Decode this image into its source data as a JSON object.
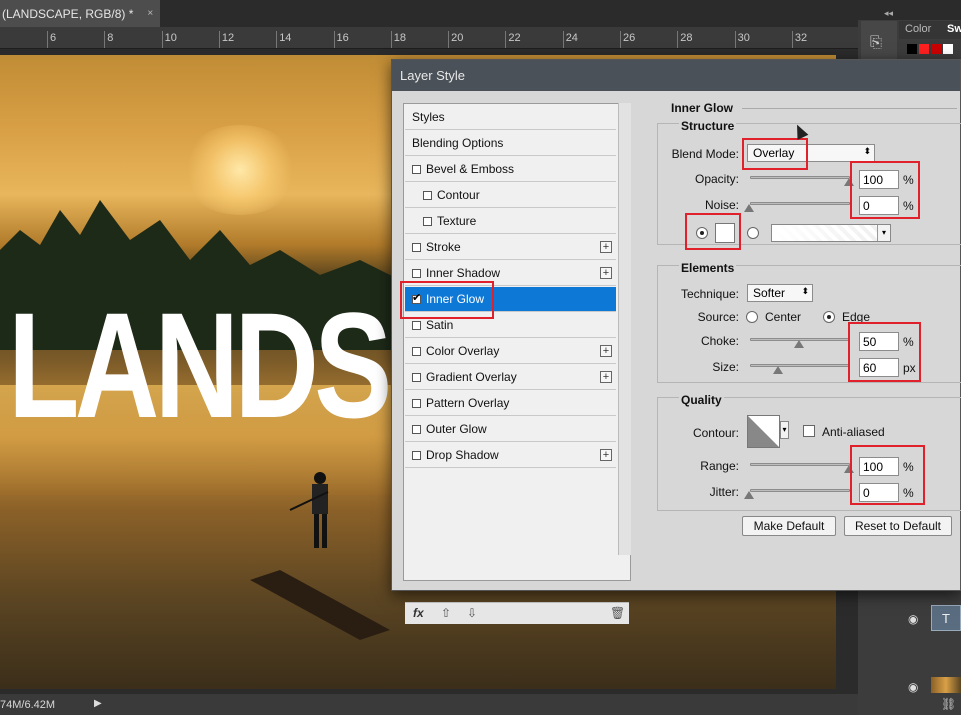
{
  "document": {
    "tab_title": "(LANDSCAPE, RGB/8) *",
    "tab_close": "×",
    "ruler_labels": [
      "6",
      "8",
      "10",
      "12",
      "14",
      "16",
      "18",
      "20",
      "22",
      "24",
      "26",
      "28",
      "30",
      "32"
    ],
    "canvas_text": "LANDS",
    "status_text": "74M/6.42M",
    "status_arrow": "▶"
  },
  "right_panel": {
    "collapse": "◂◂",
    "tab_color": "Color",
    "tab_swatches": "Sw",
    "swatch_colors": [
      "#000000",
      "#ff2020",
      "#cc0000",
      "#ffffff"
    ]
  },
  "dialog": {
    "title": "Layer Style",
    "styles": [
      {
        "label": "Styles",
        "checkbox": false,
        "checked": false,
        "plus": false,
        "indent": 0,
        "active": false
      },
      {
        "label": "Blending Options",
        "checkbox": false,
        "checked": false,
        "plus": false,
        "indent": 0,
        "active": false
      },
      {
        "label": "Bevel & Emboss",
        "checkbox": true,
        "checked": false,
        "plus": false,
        "indent": 0,
        "active": false
      },
      {
        "label": "Contour",
        "checkbox": true,
        "checked": false,
        "plus": false,
        "indent": 1,
        "active": false
      },
      {
        "label": "Texture",
        "checkbox": true,
        "checked": false,
        "plus": false,
        "indent": 1,
        "active": false
      },
      {
        "label": "Stroke",
        "checkbox": true,
        "checked": false,
        "plus": true,
        "indent": 0,
        "active": false
      },
      {
        "label": "Inner Shadow",
        "checkbox": true,
        "checked": false,
        "plus": true,
        "indent": 0,
        "active": false
      },
      {
        "label": "Inner Glow",
        "checkbox": true,
        "checked": true,
        "plus": false,
        "indent": 0,
        "active": true
      },
      {
        "label": "Satin",
        "checkbox": true,
        "checked": false,
        "plus": false,
        "indent": 0,
        "active": false
      },
      {
        "label": "Color Overlay",
        "checkbox": true,
        "checked": false,
        "plus": true,
        "indent": 0,
        "active": false
      },
      {
        "label": "Gradient Overlay",
        "checkbox": true,
        "checked": false,
        "plus": true,
        "indent": 0,
        "active": false
      },
      {
        "label": "Pattern Overlay",
        "checkbox": true,
        "checked": false,
        "plus": false,
        "indent": 0,
        "active": false
      },
      {
        "label": "Outer Glow",
        "checkbox": true,
        "checked": false,
        "plus": false,
        "indent": 0,
        "active": false
      },
      {
        "label": "Drop Shadow",
        "checkbox": true,
        "checked": false,
        "plus": true,
        "indent": 0,
        "active": false
      }
    ],
    "footer": {
      "fx": "fx",
      "up": "⇧",
      "down": "⇩",
      "trash": "🗑"
    },
    "inner_glow": {
      "heading": "Inner Glow",
      "structure": {
        "heading": "Structure",
        "blend_mode_label": "Blend Mode:",
        "blend_mode": "Overlay",
        "opacity_label": "Opacity:",
        "opacity": "100",
        "opacity_unit": "%",
        "noise_label": "Noise:",
        "noise": "0",
        "noise_unit": "%",
        "color": "#ffffff"
      },
      "elements": {
        "heading": "Elements",
        "technique_label": "Technique:",
        "technique": "Softer",
        "source_label": "Source:",
        "source_center": "Center",
        "source_edge": "Edge",
        "choke_label": "Choke:",
        "choke": "50",
        "choke_unit": "%",
        "size_label": "Size:",
        "size": "60",
        "size_unit": "px"
      },
      "quality": {
        "heading": "Quality",
        "contour_label": "Contour:",
        "anti_aliased": "Anti-aliased",
        "range_label": "Range:",
        "range": "100",
        "range_unit": "%",
        "jitter_label": "Jitter:",
        "jitter": "0",
        "jitter_unit": "%"
      },
      "make_default": "Make Default",
      "reset_default": "Reset to Default"
    }
  },
  "colors": {
    "accent": "#0e78d6",
    "highlight": "#e0202a"
  }
}
